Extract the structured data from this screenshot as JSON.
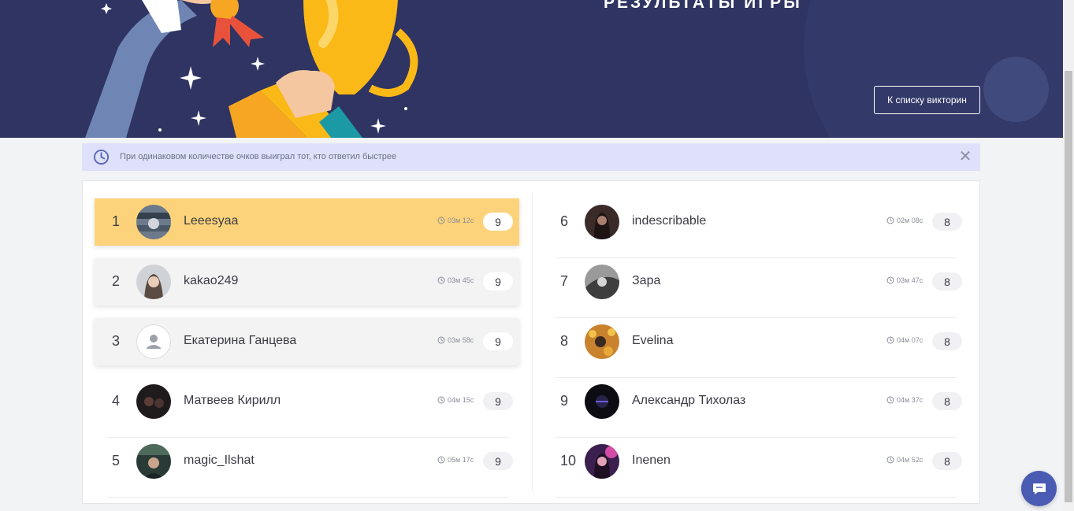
{
  "hero": {
    "title": "РЕЗУЛЬТАТЫ ИГРЫ",
    "back_button": "К списку викторин"
  },
  "notice": {
    "text": "При одинаковом количестве очков выиграл тот, кто ответил быстрее",
    "icon": "clock-icon",
    "close_icon": "close-icon"
  },
  "colors": {
    "hero_bg": "#2f3462",
    "highlight": "#fcd37a",
    "notice_bg": "#dfe1fb",
    "chat_button": "#4a5bb4"
  },
  "results": [
    {
      "rank": "1",
      "name": "Leeesyaa",
      "time": "03м 12с",
      "score": "9"
    },
    {
      "rank": "2",
      "name": "kakao249",
      "time": "03м 45с",
      "score": "9"
    },
    {
      "rank": "3",
      "name": "Екатерина Ганцева",
      "time": "03м 58с",
      "score": "9"
    },
    {
      "rank": "4",
      "name": "Матвеев Кирилл",
      "time": "04м 15с",
      "score": "9"
    },
    {
      "rank": "5",
      "name": "magic_Ilshat",
      "time": "05м 17с",
      "score": "9"
    },
    {
      "rank": "6",
      "name": "indescribable",
      "time": "02м 08с",
      "score": "8"
    },
    {
      "rank": "7",
      "name": "Зара",
      "time": "03м 47с",
      "score": "8"
    },
    {
      "rank": "8",
      "name": "Evelina",
      "time": "04м 07с",
      "score": "8"
    },
    {
      "rank": "9",
      "name": "Александр Тихолаз",
      "time": "04м 37с",
      "score": "8"
    },
    {
      "rank": "10",
      "name": "Inenen",
      "time": "04м 52с",
      "score": "8"
    }
  ]
}
